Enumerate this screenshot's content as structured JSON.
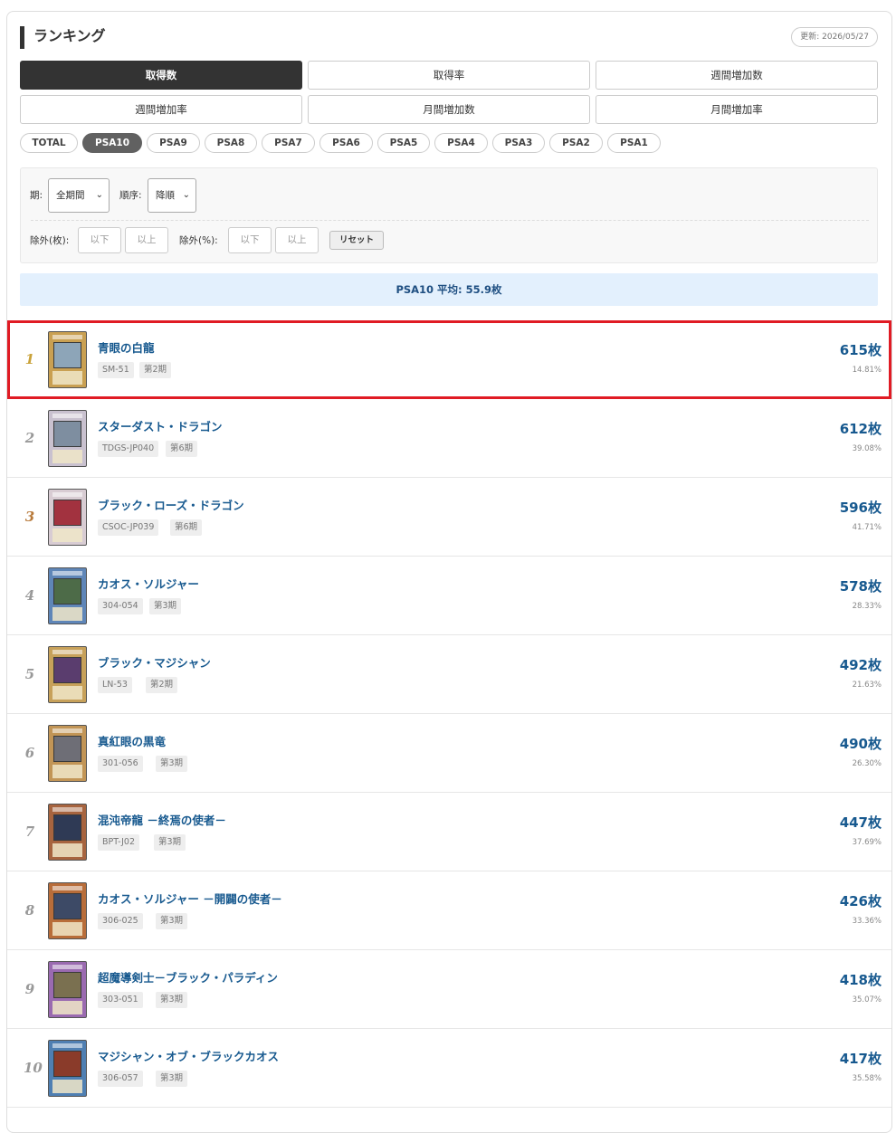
{
  "header": {
    "title": "ランキング",
    "updated": "更新: 2026/05/27"
  },
  "sort_tabs": [
    {
      "label": "取得数",
      "active": true
    },
    {
      "label": "取得率",
      "active": false
    },
    {
      "label": "週間増加数",
      "active": false
    },
    {
      "label": "週間増加率",
      "active": false
    },
    {
      "label": "月間増加数",
      "active": false
    },
    {
      "label": "月間増加率",
      "active": false
    }
  ],
  "grade_filters": [
    {
      "label": "TOTAL",
      "active": false
    },
    {
      "label": "PSA10",
      "active": true
    },
    {
      "label": "PSA9",
      "active": false
    },
    {
      "label": "PSA8",
      "active": false
    },
    {
      "label": "PSA7",
      "active": false
    },
    {
      "label": "PSA6",
      "active": false
    },
    {
      "label": "PSA5",
      "active": false
    },
    {
      "label": "PSA4",
      "active": false
    },
    {
      "label": "PSA3",
      "active": false
    },
    {
      "label": "PSA2",
      "active": false
    },
    {
      "label": "PSA1",
      "active": false
    }
  ],
  "filters": {
    "period_label": "期:",
    "period_value": "全期間",
    "order_label": "順序:",
    "order_value": "降順",
    "exclude_count_label": "除外(枚):",
    "exclude_count_max_placeholder": "以下",
    "exclude_count_min_placeholder": "以上",
    "exclude_pct_label": "除外(%):",
    "exclude_pct_max_placeholder": "以下",
    "exclude_pct_min_placeholder": "以上",
    "reset_label": "リセット"
  },
  "average": "PSA10 平均: 55.9枚",
  "rows": [
    {
      "rank": "1",
      "name": "青眼の白龍",
      "code": "SM-51",
      "period": "第2期",
      "count": "615枚",
      "pct": "14.81%"
    },
    {
      "rank": "2",
      "name": "スターダスト・ドラゴン",
      "code": "TDGS-JP040",
      "period": "第6期",
      "count": "612枚",
      "pct": "39.08%"
    },
    {
      "rank": "3",
      "name": "ブラック・ローズ・ドラゴン",
      "code": "CSOC-JP039",
      "period": "第6期",
      "count": "596枚",
      "pct": "41.71%"
    },
    {
      "rank": "4",
      "name": "カオス・ソルジャー",
      "code": "304-054",
      "period": "第3期",
      "count": "578枚",
      "pct": "28.33%"
    },
    {
      "rank": "5",
      "name": "ブラック・マジシャン",
      "code": "LN-53",
      "period": "第2期",
      "count": "492枚",
      "pct": "21.63%"
    },
    {
      "rank": "6",
      "name": "真紅眼の黒竜",
      "code": "301-056",
      "period": "第3期",
      "count": "490枚",
      "pct": "26.30%"
    },
    {
      "rank": "7",
      "name": "混沌帝龍 －終焉の使者－",
      "code": "BPT-J02",
      "period": "第3期",
      "count": "447枚",
      "pct": "37.69%"
    },
    {
      "rank": "8",
      "name": "カオス・ソルジャー －開闢の使者－",
      "code": "306-025",
      "period": "第3期",
      "count": "426枚",
      "pct": "33.36%"
    },
    {
      "rank": "9",
      "name": "超魔導剣士－ブラック・パラディン",
      "code": "303-051",
      "period": "第3期",
      "count": "418枚",
      "pct": "35.07%"
    },
    {
      "rank": "10",
      "name": "マジシャン・オブ・ブラックカオス",
      "code": "306-057",
      "period": "第3期",
      "count": "417枚",
      "pct": "35.58%"
    }
  ],
  "colors": {
    "accent": "#17598f",
    "highlight": "#e01b24",
    "gold": "#c9a23a",
    "bronze": "#b87a3b",
    "avg_bg": "#e3f0fd"
  }
}
